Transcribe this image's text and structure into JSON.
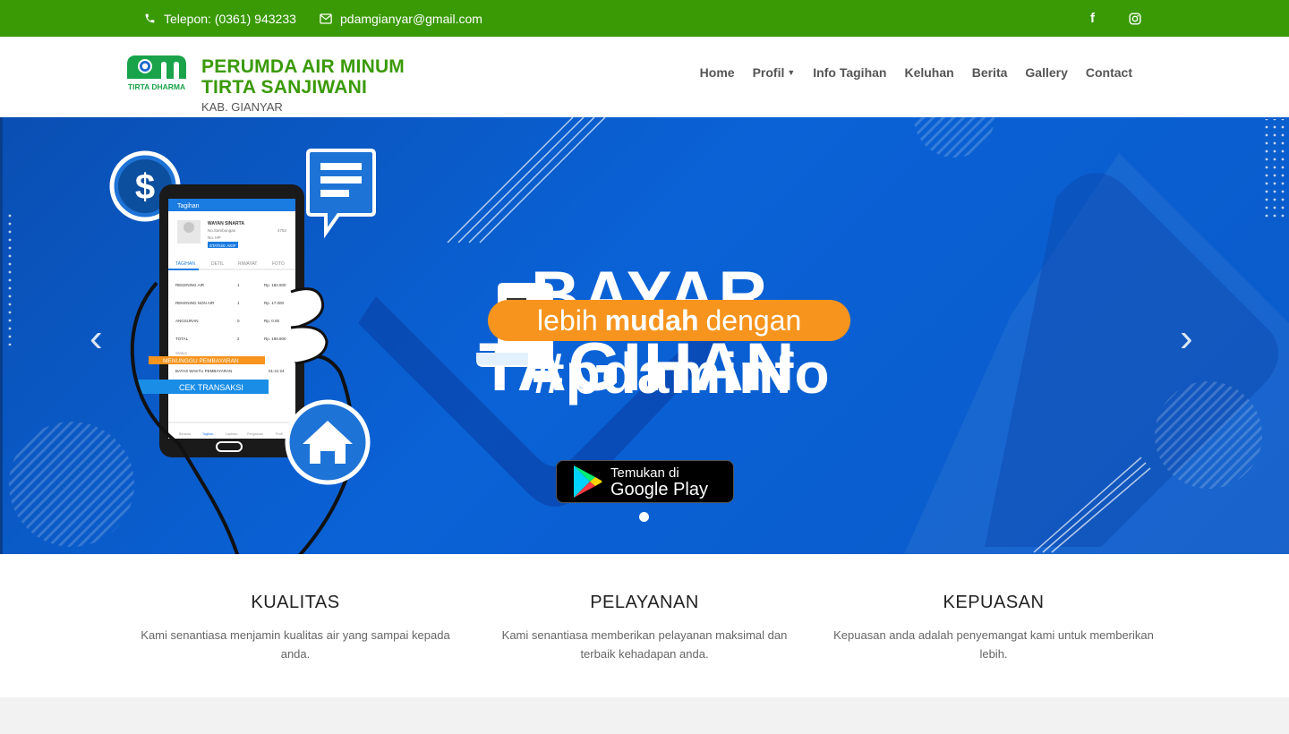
{
  "topbar": {
    "phone": "Telepon: (0361) 943233",
    "email": "pdamgianyar@gmail.com",
    "facebook_icon": "f",
    "instagram_icon": "instagram-icon"
  },
  "brand": {
    "logo_text": "TIRTA DHARMA",
    "title_line1": "PERUMDA AIR MINUM",
    "title_line2": "TIRTA SANJIWANI",
    "subtitle": "KAB. GIANYAR"
  },
  "nav": [
    {
      "label": "Home"
    },
    {
      "label": "Profil"
    },
    {
      "label": "Info Tagihan"
    },
    {
      "label": "Keluhan"
    },
    {
      "label": "Berita"
    },
    {
      "label": "Gallery"
    },
    {
      "label": "Contact"
    }
  ],
  "hero": {
    "headline_line1": "BAYAR",
    "headline_line2": "TAGIHAN",
    "pill_pre": "lebih",
    "pill_bold": "mudah",
    "pill_post": "dengan",
    "hashtag": "#pdaminfo",
    "gplay_small": "Temukan di",
    "gplay_big": "Google Play",
    "phone_screen": {
      "title": "Tagihan",
      "name": "WAYAN SINARTA",
      "sambungan_label": "No.Sambungan",
      "sambungan_value": "4752",
      "hp_label": "No. HP",
      "status": "STATUS: AKIF",
      "tabs": [
        "TAGIHAN",
        "DETIL",
        "RIWAYAT",
        "FOTO"
      ],
      "rows": [
        {
          "label": "REKENING AIR",
          "qty": "1",
          "amount": "Rp. 182.800"
        },
        {
          "label": "REKENING NON AIR",
          "qty": "1",
          "amount": "Rp. 17.000"
        },
        {
          "label": "ANGSURAN",
          "qty": "0",
          "amount": "Rp. 0.00"
        },
        {
          "label": "TOTAL",
          "qty": "2",
          "amount": "Rp. 199.800"
        }
      ],
      "status_label": "Status",
      "waiting": "MENUNGGU PEMBAYARAN",
      "deadline_label": "BATAS WAKTU PEMBAYARAN",
      "deadline_value": "01:41:24",
      "check_button": "CEK TRANSAKSI",
      "bottom_nav": [
        "Beranda",
        "Tagihan",
        "Layanan",
        "Pengaduan",
        "Profil"
      ]
    },
    "prev_glyph": "‹",
    "next_glyph": "›"
  },
  "features": [
    {
      "title": "KUALITAS",
      "text": "Kami senantiasa menjamin kualitas air yang sampai kepada anda."
    },
    {
      "title": "PELAYANAN",
      "text": "Kami senantiasa memberikan pelayanan maksimal dan terbaik kehadapan anda."
    },
    {
      "title": "KEPUASAN",
      "text": "Kepuasan anda adalah penyemangat kami untuk memberikan lebih."
    }
  ],
  "colors": {
    "brand_green": "#3a9a06",
    "hero_blue": "#0a5ccf",
    "accent_orange": "#f7941d"
  }
}
